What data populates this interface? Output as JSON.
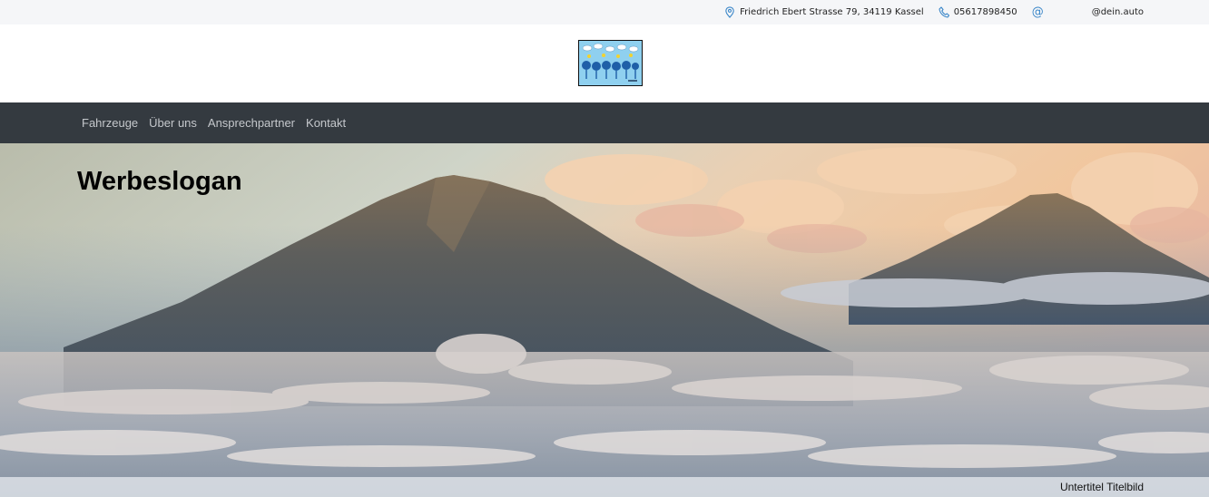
{
  "topbar": {
    "address": "Friedrich Ebert Strasse 79, 34119 Kassel",
    "phone": "05617898450",
    "email": "@dein.auto",
    "icons": [
      "location-pin-icon",
      "phone-icon",
      "at-icon"
    ]
  },
  "nav": {
    "items": [
      {
        "label": "Fahrzeuge"
      },
      {
        "label": "Über uns"
      },
      {
        "label": "Ansprechpartner"
      },
      {
        "label": "Kontakt"
      }
    ]
  },
  "hero": {
    "slogan": "Werbeslogan",
    "subtitle": "Untertitel Titelbild"
  },
  "colors": {
    "nav_bg": "#343a40",
    "nav_text": "#c5c8cc",
    "topbar_bg": "#f5f6f8",
    "icon_blue": "#3a86c8"
  }
}
